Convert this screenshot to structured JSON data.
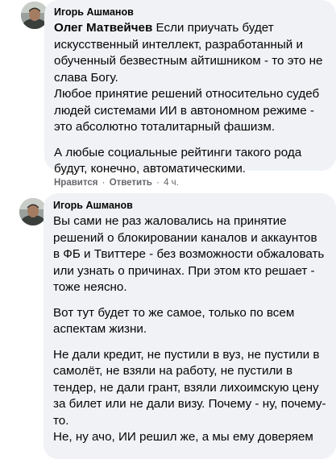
{
  "comments": [
    {
      "author": "Игорь Ашманов",
      "mention": "Олег Матвейчев",
      "paragraphs": [
        [
          " Если приучать будет",
          "искусственный интеллект, разработанный и",
          "обученный безвестным айтишником - то это не",
          "слава Богу.",
          "Любое принятие решений относительно судеб",
          "людей системами ИИ в автономном режиме -",
          "это абсолютно тоталитарный фашизм."
        ],
        [
          "А любые социальные рейтинги такого рода",
          "будут, конечно, автоматическими."
        ]
      ],
      "actions": {
        "like": "Нравится",
        "reply": "Ответить",
        "time": "4 ч."
      }
    },
    {
      "author": "Игорь Ашманов",
      "paragraphs": [
        [
          "Вы сами не раз жаловались на принятие",
          "решений о блокировании каналов и аккаунтов",
          "в ФБ и Твиттере - без возможности обжаловать",
          "или узнать о причинах. При этом кто решает -",
          "тоже неясно."
        ],
        [
          "Вот тут будет то же самое, только по всем",
          "аспектам жизни."
        ],
        [
          "Не дали кредит, не пустили в вуз, не пустили в",
          "самолёт, не взяли на работу, не пустили в",
          "тендер, не дали грант, взяли лихоимскую цену",
          "за билет или не дали визу. Почему - ну, почему-",
          "то.",
          "Не, ну ачо, ИИ решил же, а мы ему доверяем"
        ]
      ]
    }
  ],
  "separators": {
    "dot": " · "
  }
}
